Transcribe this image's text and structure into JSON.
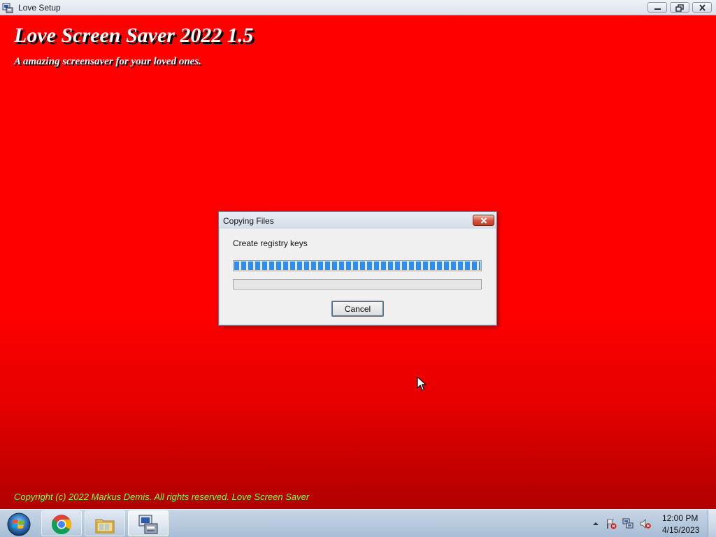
{
  "window": {
    "title": "Love Setup",
    "icon": "setup-icon",
    "controls": [
      "minimize",
      "restore",
      "close"
    ]
  },
  "installer": {
    "title": "Love Screen Saver 2022 1.5",
    "subtitle": "A amazing screensaver for your loved ones.",
    "copyright": "Copyright (c) 2022 Markus Demis. All rights reserved. Love Screen Saver",
    "colors": {
      "background": "#ff0000",
      "background_bottom": "#b00000",
      "copyright_text": "#7cff3c"
    }
  },
  "dialog": {
    "title": "Copying Files",
    "status": "Create registry keys",
    "progress_primary": 1.0,
    "progress_secondary": 0.0,
    "cancel_label": "Cancel",
    "accent_color": "#2e8ef0"
  },
  "taskbar": {
    "items": [
      {
        "icon": "windows-start-icon"
      },
      {
        "icon": "chrome-icon"
      },
      {
        "icon": "file-explorer-icon"
      },
      {
        "icon": "setup-icon",
        "active": true
      }
    ],
    "tray_icons": [
      "show-hidden-icons-icon",
      "action-center-flag-icon",
      "network-icon",
      "volume-muted-icon"
    ],
    "clock": {
      "time": "12:00 PM",
      "date": "4/15/2023"
    }
  }
}
